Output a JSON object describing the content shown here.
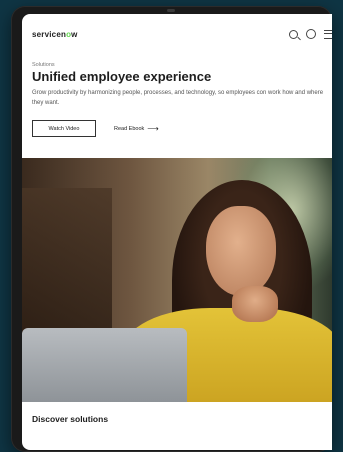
{
  "nav": {
    "logo_text_a": "servicen",
    "logo_text_o": "o",
    "logo_text_b": "w",
    "icons": [
      "search-icon",
      "user-icon",
      "menu-icon"
    ]
  },
  "hero": {
    "breadcrumb": "Solutions",
    "title": "Unified employee experience",
    "description": "Grow productivity by harmonizing people, processes, and technology, so employees con work how and where they want.",
    "primary_button": "Watch Video",
    "secondary_link": "Read Ebook"
  },
  "section": {
    "heading": "Discover solutions"
  },
  "colors": {
    "logo_accent": "#62d84e",
    "text_dark": "#1d1d1d",
    "device_bezel": "#1a1a1a",
    "background": "#0f3544"
  }
}
